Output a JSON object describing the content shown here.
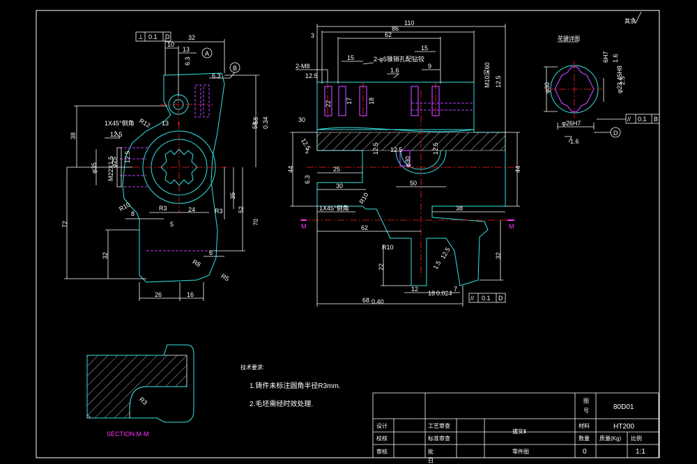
{
  "colors": {
    "background": "#000000",
    "outline": "#33e6e6",
    "dimension": "#ffffff",
    "center": "#ff2020",
    "hidden": "#c040ff",
    "section": "#ff33ff"
  },
  "roughness": {
    "symbol": "✓",
    "label": "其余"
  },
  "left_view": {
    "fcf_top": {
      "sym": "⊥",
      "tol": "0.1",
      "datum": "D"
    },
    "dims": {
      "d32": "32",
      "d10": "10",
      "d13": "13",
      "d63": "6.3",
      "d63b": "6.3",
      "d38": "38",
      "d58": "58",
      "d72": "72",
      "d70": "70",
      "d52": "52",
      "d35": "35",
      "d32b": "32",
      "d26": "26",
      "d16": "16",
      "d6": "6",
      "d24": "24",
      "d5": "5",
      "d6b": "6",
      "d13b": "13",
      "d8": "8",
      "d58tol": "58",
      "d58tolsub": "0.34"
    },
    "labels": {
      "cham": "1X45°倒角",
      "ra125": "12.5",
      "r12": "R12",
      "r10": "R10",
      "r3a": "R3",
      "r3b": "R3",
      "r8": "R8",
      "r5": "R5",
      "phi35": "φ35",
      "m22": "M22X1.5",
      "phi25": "φ25",
      "d125b": "12.5"
    },
    "datum_a": "A",
    "datum_b": "B"
  },
  "front_view": {
    "dims": {
      "d110": "110",
      "d86": "86",
      "d62": "62",
      "d3": "3",
      "d15a": "15",
      "d15b": "15",
      "d9": "9",
      "d22": "22",
      "d17": "17",
      "d18": "18",
      "d30": "30",
      "d2": "2",
      "d44a": "44",
      "d25": "25",
      "d30b": "30",
      "d44b": "44",
      "d50": "50",
      "d38": "38",
      "d62b": "62",
      "d22b": "22",
      "d32": "32",
      "d12": "12",
      "d18b": "18",
      "d7": "7",
      "d68": "68",
      "d68tol": "0.40",
      "d024": "0.024"
    },
    "labels": {
      "m8": "2-M8",
      "holes": "2-φ5锥销孔配钻铰",
      "m10": "M10深60",
      "ra16a": "1.6",
      "ra125a": "12.5",
      "ra125b": "12.5",
      "ra125c": "12.5",
      "ra125d": "12.5",
      "ra63": "6.3",
      "cham": "1X45°倒角",
      "r10": "R10",
      "r10b": "R10",
      "ra15": "1.5",
      "phi30": "φ30",
      "m": "M"
    },
    "fcf_bottom": {
      "sym": "//",
      "tol": "0.1",
      "datum": "D"
    }
  },
  "right_view": {
    "title": "花键详图",
    "dims": {
      "phi30": "φ30",
      "phi26": "φ26H7",
      "phi23": "φ23.45H8",
      "ra16": "1.6",
      "ra16b": "1.6",
      "ra16c": "1.6",
      "w6": "6H7",
      "ra25": "2.5"
    },
    "fcf": {
      "sym": "//",
      "tol": "0.1",
      "datum": "B"
    },
    "datum": "D"
  },
  "section": {
    "label": "SECTION  M-M",
    "r3": "R3"
  },
  "notes": {
    "title": "技术要求:",
    "n1": "1.铸件未标注圆角半径R3mm.",
    "n2": "2.毛坯需经时效处理."
  },
  "title_block": {
    "code": "80D01",
    "drawing_no_label1": "图",
    "drawing_no_label2": "号",
    "design": "设计",
    "check": "校核",
    "review": "审核",
    "process": "工艺审查",
    "standard": "标准审查",
    "approve": "批",
    "date": "日",
    "part_name": "拔叉Ⅱ",
    "part_no": "零件图",
    "material_label": "材料",
    "material": "HT200",
    "qty_label": "数量",
    "mass_label": "质量(Kg)",
    "scale_label": "比例",
    "qty": "0",
    "scale": "1:1"
  }
}
